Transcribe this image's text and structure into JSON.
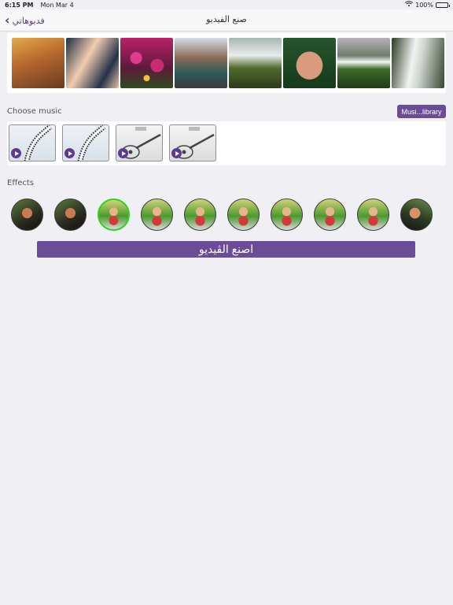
{
  "status_bar": {
    "time": "6:15 PM",
    "date": "Mon Mar 4",
    "battery": "100%",
    "battery_level": 1.0,
    "wifi_icon": "wifi-icon",
    "battery_icon": "battery-icon"
  },
  "nav": {
    "back_label": "فديوهاتي",
    "back_icon": "chevron-left-icon",
    "title": "صنع الفيديو"
  },
  "photos": [
    {
      "id": "photo-1"
    },
    {
      "id": "photo-2"
    },
    {
      "id": "photo-3"
    },
    {
      "id": "photo-4"
    },
    {
      "id": "photo-5"
    },
    {
      "id": "photo-6"
    },
    {
      "id": "photo-7"
    },
    {
      "id": "photo-8"
    }
  ],
  "music": {
    "label": "Choose music",
    "library_button": "Musi...library",
    "play_icon": "play-icon",
    "tracks": [
      {
        "style": "piano"
      },
      {
        "style": "piano"
      },
      {
        "style": "guitar"
      },
      {
        "style": "guitar"
      }
    ]
  },
  "effects": {
    "label": "Effects",
    "selected_index": 2,
    "selected_color": "#2bd41d",
    "count": 10
  },
  "make_video_button": "اصنع الڤيديو",
  "colors": {
    "accent": "#6b4c96",
    "nav_tint": "#5a3b8f",
    "background": "#efeff4"
  }
}
